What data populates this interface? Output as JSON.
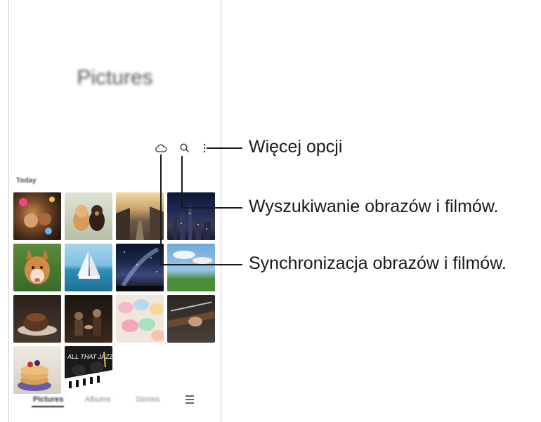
{
  "screen": {
    "title": "Pictures",
    "section_label": "Today",
    "tabs": [
      {
        "label": "Pictures",
        "active": true
      },
      {
        "label": "Albums",
        "active": false
      },
      {
        "label": "Stories",
        "active": false
      }
    ]
  },
  "toolbar": {
    "icons": [
      "cloud-sync-icon",
      "search-icon",
      "more-options-icon"
    ]
  },
  "callouts": {
    "more_options": "Więcej opcji",
    "search": "Wyszukiwanie obrazów i filmów.",
    "sync": "Synchronizacja obrazów i filmów."
  },
  "thumbnails": [
    "party-photo",
    "puppies-photo",
    "alley-photo",
    "city-night-photo",
    "corgi-photo",
    "sailboat-photo",
    "starry-sky-photo",
    "meadow-photo",
    "cake-photo",
    "band-photo",
    "macarons-photo",
    "guitar-photo",
    "pancakes-photo",
    "all-that-jazz-poster"
  ],
  "poster_text": "ALL THAT JAZZ",
  "colors": {
    "callout_line": "#1a1a1a",
    "tab_active": "#333333"
  }
}
